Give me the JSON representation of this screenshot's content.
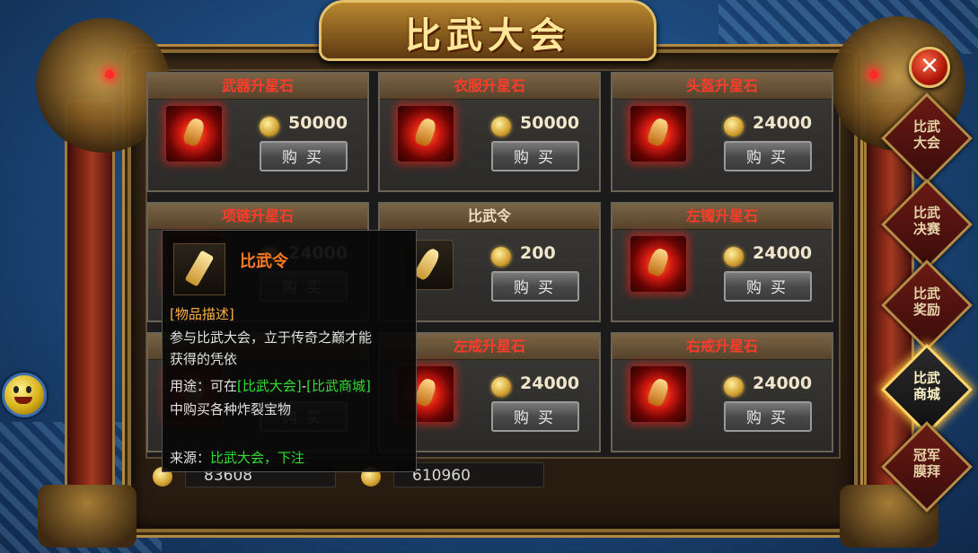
{
  "title": "比武大会",
  "close_symbol": "✕",
  "side_tabs": [
    {
      "label": "比武\n大会",
      "active": false
    },
    {
      "label": "比武\n决赛",
      "active": false
    },
    {
      "label": "比武\n奖励",
      "active": false
    },
    {
      "label": "比武\n商城",
      "active": true
    },
    {
      "label": "冠军\n膜拜",
      "active": false
    }
  ],
  "shop_items": [
    {
      "name": "武器升星石",
      "name_color": "#ff3b2a",
      "price": "50000",
      "buy_label": "购买",
      "icon": "red-star-stone-icon"
    },
    {
      "name": "衣服升星石",
      "name_color": "#ff3b2a",
      "price": "50000",
      "buy_label": "购买",
      "icon": "red-star-stone-icon"
    },
    {
      "name": "头盔升星石",
      "name_color": "#ff3b2a",
      "price": "24000",
      "buy_label": "购买",
      "icon": "red-star-stone-icon"
    },
    {
      "name": "项链升星石",
      "name_color": "#ff3b2a",
      "price": "24000",
      "buy_label": "购买",
      "icon": "red-star-stone-icon"
    },
    {
      "name": "比武令",
      "name_color": "#f1e0c0",
      "price": "200",
      "buy_label": "购买",
      "icon": "tournament-token-icon"
    },
    {
      "name": "左镯升星石",
      "name_color": "#ff3b2a",
      "price": "24000",
      "buy_label": "购买",
      "icon": "red-star-stone-icon"
    },
    {
      "name": "",
      "name_color": "#ff3b2a",
      "price": "",
      "buy_label": "购买",
      "icon": "red-star-stone-icon"
    },
    {
      "name": "左戒升星石",
      "name_color": "#ff3b2a",
      "price": "24000",
      "buy_label": "购买",
      "icon": "red-star-stone-icon"
    },
    {
      "name": "右戒升星石",
      "name_color": "#ff3b2a",
      "price": "24000",
      "buy_label": "购买",
      "icon": "red-star-stone-icon"
    }
  ],
  "currency": {
    "gold": "83608",
    "tokens": "610960"
  },
  "tooltip": {
    "name": "比武令",
    "desc_header": "[物品描述]",
    "desc_line1": "参与比武大会，立于传奇之巅才能",
    "desc_line2": "获得的凭依",
    "use_prefix": "用途：可在",
    "use_link1": "[比武大会]",
    "use_dash": "-",
    "use_link2": "[比武商城]",
    "use_line2": "中购买各种炸裂宝物",
    "source_label": "来源：",
    "source_value": "比武大会，下注"
  }
}
